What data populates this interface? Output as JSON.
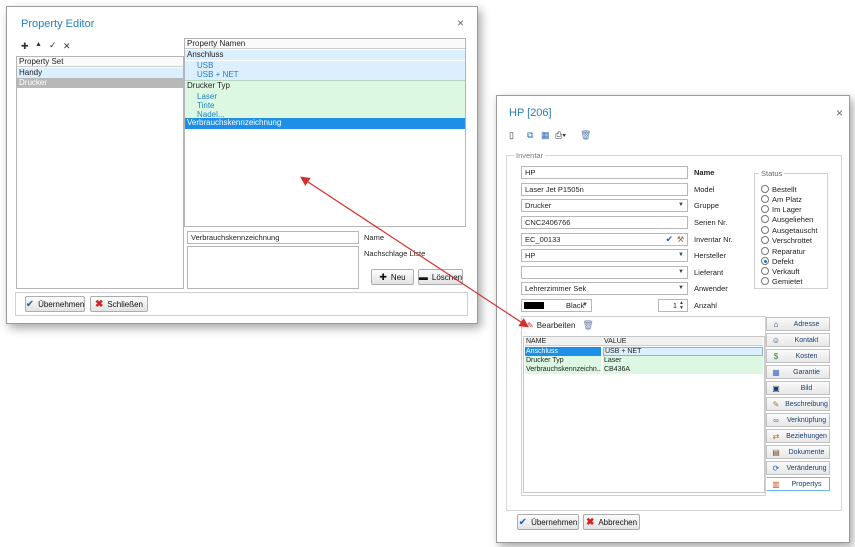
{
  "property_editor": {
    "title": "Property Editor",
    "close": "×",
    "toolbar": {
      "add": "✚",
      "up": "▲",
      "check": "✓",
      "remove": "✕"
    },
    "set_header": "Property Set",
    "sets": [
      "Handy",
      "Drucker"
    ],
    "names_header": "Property Namen",
    "tree": [
      {
        "label": "Anschluss",
        "children": [
          "USB",
          "USB + NET"
        ],
        "level": 0
      },
      {
        "label": "Drucker Typ",
        "children": [
          "Laser",
          "Tinte",
          "Nadel..."
        ],
        "level": 0
      },
      {
        "label": "Verbrauchskennzeichnung",
        "children": [],
        "level": 0,
        "selected": true
      }
    ],
    "name_value": "Verbrauchskennzeichnung",
    "name_label": "Name",
    "suggest_label": "Nachschlage Liste",
    "new_button": "Neu",
    "delete_button": "Löschen",
    "apply_button": "Übernehmen",
    "close_button": "Schließen"
  },
  "hp_dialog": {
    "title": "HP [206]",
    "close": "×",
    "group_label": "Inventar",
    "fields": {
      "name": {
        "value": "HP",
        "label": "Name"
      },
      "model": {
        "value": "Laser Jet P1505n",
        "label": "Model"
      },
      "gruppe": {
        "value": "Drucker",
        "label": "Gruppe"
      },
      "serien": {
        "value": "CNC2406766",
        "label": "Serien Nr."
      },
      "inventar": {
        "value": "EC_00133",
        "label": "Inventar Nr."
      },
      "hersteller": {
        "value": "HP",
        "label": "Hersteller"
      },
      "lieferant": {
        "value": "",
        "label": "Lieferant"
      },
      "anwender": {
        "value": "Lehrerzimmer Sek",
        "label": "Anwender"
      },
      "color": {
        "value": "Black",
        "label": ""
      },
      "anzahl": {
        "value": "1",
        "label": "Anzahl"
      }
    },
    "status_label": "Status",
    "status": [
      "Bestellt",
      "Am Platz",
      "Im Lager",
      "Ausgeliehen",
      "Ausgetauscht",
      "Verschrottet",
      "Reparatur",
      "Defekt",
      "Verkauft",
      "Gemietet"
    ],
    "status_selected": "Defekt",
    "edit_label": "Bearbeiten",
    "grid_headers": [
      "NAME",
      "VALUE"
    ],
    "grid_rows": [
      {
        "name": "Anschluss",
        "value": "USB + NET"
      },
      {
        "name": "Drucker Typ",
        "value": "Laser"
      },
      {
        "name": "Verbrauchskennzeichn...",
        "value": "CB436A"
      }
    ],
    "side_tabs": [
      {
        "label": "Adresse",
        "icon": "⌂"
      },
      {
        "label": "Kontakt",
        "icon": "☺"
      },
      {
        "label": "Kosten",
        "icon": "$"
      },
      {
        "label": "Garantie",
        "icon": "▦"
      },
      {
        "label": "Bild",
        "icon": "▣"
      },
      {
        "label": "Beschreibung",
        "icon": "✎"
      },
      {
        "label": "Verknüpfung",
        "icon": "∞"
      },
      {
        "label": "Beziehungen",
        "icon": "⇄"
      },
      {
        "label": "Dokumente",
        "icon": "▤"
      },
      {
        "label": "Veränderung",
        "icon": "⟳"
      },
      {
        "label": "Propertys",
        "icon": "▥"
      }
    ],
    "active_tab": "Propertys",
    "apply_button": "Übernehmen",
    "cancel_button": "Abbrechen"
  },
  "colors": {
    "accent": "#1f7fc4",
    "selected": "#1e8fe6",
    "blue_group": "#dcefff",
    "green_group": "#dcf8e2",
    "arrow": "#d43030"
  }
}
